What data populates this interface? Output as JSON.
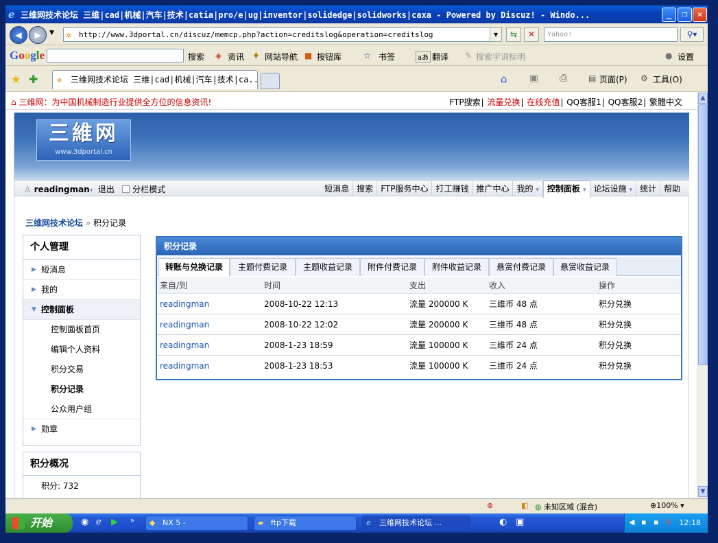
{
  "window": {
    "title": "三维网技术论坛 三维|cad|机械|汽车|技术|catia|pro/e|ug|inventor|solidedge|solidworks|caxa - Powered by Discuz! - Windo..."
  },
  "browser": {
    "address": "http://www.3dportal.cn/discuz/memcp.php?action=creditslog&operation=creditslog",
    "search_placeholder": "Yahoo!",
    "google_toolbar": {
      "logo": "Google",
      "search_label": "搜索",
      "news_label": "资讯",
      "nav_label": "网站导航",
      "buttons_label": "按钮库",
      "bookmarks_label": "书签",
      "translate_label": "翻译",
      "highlight_label": "搜索字词标明",
      "settings_label": "设置"
    },
    "tab_title": "三维网技术论坛 三维|cad|机械|汽车|技术|ca...",
    "page_menu": "页面(P)",
    "tools_menu": "工具(O)"
  },
  "site": {
    "slogan": "三维网：为中国机械制造行业提供全方位的信息资讯!",
    "top_links": [
      "FTP搜索",
      "流量兑换",
      "在线充值",
      "QQ客服1",
      "QQ客服2",
      "繁體中文"
    ],
    "logo_text": "三維网",
    "logo_url": "www.3dportal.cn"
  },
  "navbar": {
    "username": "readingman",
    "logout": "退出",
    "split_mode": "分栏模式",
    "menu": [
      "短消息",
      "搜索",
      "FTP服务中心",
      "打工赚钱",
      "推广中心",
      "我的",
      "控制面板",
      "论坛设施",
      "统计",
      "帮助"
    ],
    "active_menu": "控制面板"
  },
  "breadcrumb": {
    "home": "三维网技术论坛",
    "separator": "»",
    "current": "积分记录"
  },
  "sidebar": {
    "title": "个人管理",
    "items": [
      {
        "label": "短消息"
      },
      {
        "label": "我的"
      },
      {
        "label": "控制面板"
      }
    ],
    "subitems": [
      "控制面板首页",
      "编辑个人资料",
      "积分交易",
      "积分记录",
      "公众用户组"
    ],
    "medal": "勋章",
    "summary_title": "积分概况",
    "summary_value": "积分: 732"
  },
  "panel": {
    "title": "积分记录",
    "tabs": [
      "转账与兑换记录",
      "主题付费记录",
      "主题收益记录",
      "附件付费记录",
      "附件收益记录",
      "悬赏付费记录",
      "悬赏收益记录"
    ],
    "columns": [
      "来自/到",
      "时间",
      "支出",
      "收入",
      "操作"
    ],
    "rows": [
      {
        "from": "readingman",
        "time": "2008-10-22 12:13",
        "out": "流量  200000 K",
        "in": "三维币  48 点",
        "op": "积分兑换"
      },
      {
        "from": "readingman",
        "time": "2008-10-22 12:02",
        "out": "流量  200000 K",
        "in": "三维币  48 点",
        "op": "积分兑换"
      },
      {
        "from": "readingman",
        "time": "2008-1-23 18:59",
        "out": "流量  100000 K",
        "in": "三维币  24 点",
        "op": "积分兑换"
      },
      {
        "from": "readingman",
        "time": "2008-1-23 18:53",
        "out": "流量  100000 K",
        "in": "三维币  24 点",
        "op": "积分兑换"
      }
    ]
  },
  "statusbar": {
    "zone": "未知区域 (混合)",
    "zoom": "100%"
  },
  "taskbar": {
    "start": "开始",
    "buttons": [
      "NX 5 -",
      "ftp下载",
      "三维网技术论坛 ..."
    ],
    "clock": "12:18"
  },
  "colors": {
    "accent": "#3a78c8",
    "link": "#1a56b0",
    "slogan": "#cc0000"
  }
}
